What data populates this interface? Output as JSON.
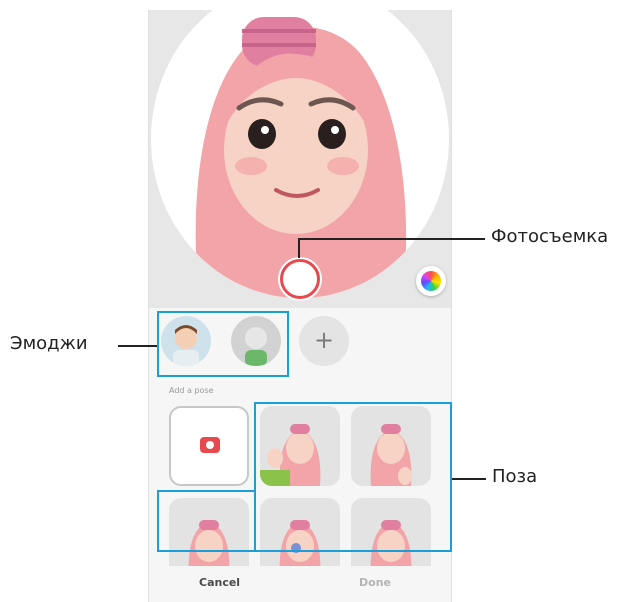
{
  "callouts": {
    "shutter": "Фотосъемка",
    "emoji": "Эмоджи",
    "pose": "Поза"
  },
  "screen": {
    "add_button": "+",
    "section_label": "Add a pose",
    "cancel": "Cancel",
    "done": "Done"
  },
  "colors": {
    "accent": "#e64a4f",
    "highlight": "#1a9fd8",
    "avatar_hair": "#f2a4a8",
    "avatar_skin": "#f7d3c6"
  }
}
